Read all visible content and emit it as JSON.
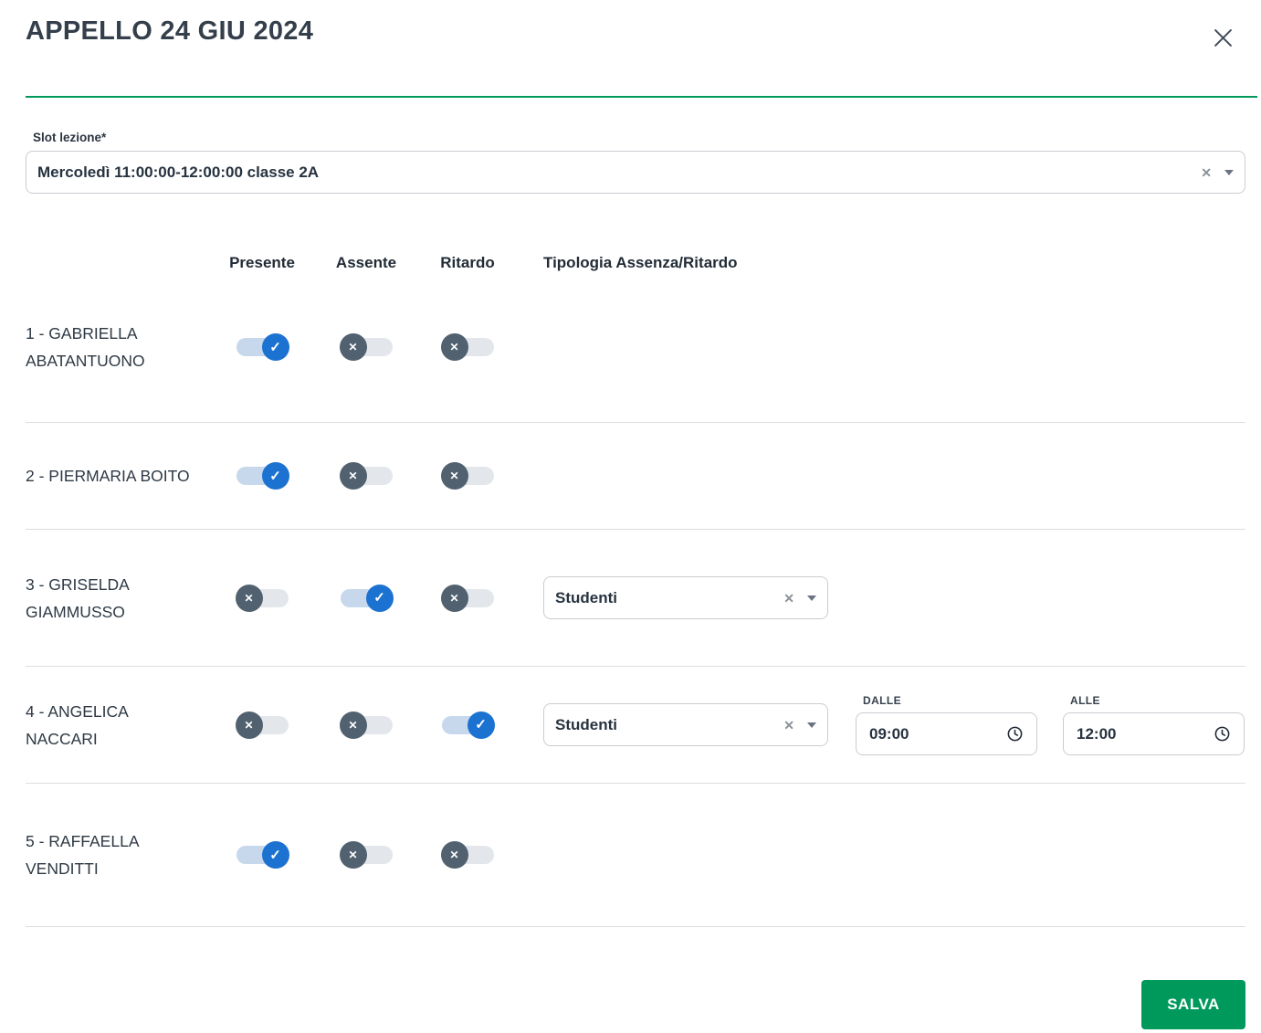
{
  "modal": {
    "title": "APPELLO 24 GIU 2024"
  },
  "slot": {
    "label": "Slot lezione*",
    "value": "Mercoledì 11:00:00-12:00:00 classe 2A"
  },
  "headers": {
    "presente": "Presente",
    "assente": "Assente",
    "ritardo": "Ritardo",
    "tipologia": "Tipologia Assenza/Ritardo"
  },
  "time_labels": {
    "dalle": "DALLE",
    "alle": "ALLE"
  },
  "rows": [
    {
      "name": "1 - GABRIELLA ABATANTUONO",
      "presente": true,
      "assente": false,
      "ritardo": false
    },
    {
      "name": "2 - PIERMARIA BOITO",
      "presente": true,
      "assente": false,
      "ritardo": false
    },
    {
      "name": "3 - GRISELDA GIAMMUSSO",
      "presente": false,
      "assente": true,
      "ritardo": false,
      "tipologia": "Studenti"
    },
    {
      "name": "4 - ANGELICA NACCARI",
      "presente": false,
      "assente": false,
      "ritardo": true,
      "tipologia": "Studenti",
      "dalle": "09:00",
      "alle": "12:00"
    },
    {
      "name": "5 - RAFFAELLA VENDITTI",
      "presente": true,
      "assente": false,
      "ritardo": false
    }
  ],
  "footer": {
    "save_label": "SALVA"
  },
  "icons": {
    "check": "✓",
    "cross": "✕",
    "clear": "✕"
  },
  "colors": {
    "accent_green": "#00995C",
    "toggle_on_blue": "#1B72D0",
    "toggle_off_knob": "#51616F",
    "toggle_on_track": "#C7D8EC",
    "toggle_off_track": "#E3E7EB"
  }
}
